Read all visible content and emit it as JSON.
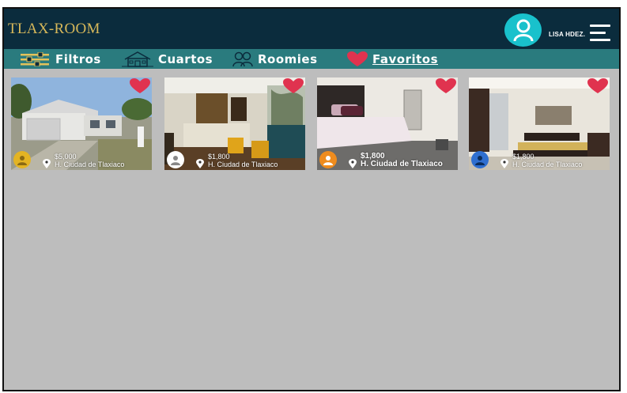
{
  "app": {
    "logo": "TLAX-ROOM"
  },
  "header": {
    "username": "LISA HDEZ."
  },
  "nav": {
    "filtros": "Filtros",
    "cuartos": "Cuartos",
    "roomies": "Roomies",
    "favoritos": "Favoritos"
  },
  "colors": {
    "topbar": "#0b2c3d",
    "navbar": "#2a7b7e",
    "logo": "#d7b85a",
    "heart": "#e0334f",
    "avatar": "#19c1cc",
    "content_bg": "#bdbdbd"
  },
  "listings": [
    {
      "price": "$5,000",
      "location": "H. Ciudad de Tlaxiaco",
      "owner_color": "#e3b423",
      "favorite": true
    },
    {
      "price": "$1,800",
      "location": "H. Ciudad de Tlaxiaco",
      "owner_color": "#ffffff",
      "favorite": true
    },
    {
      "price": "$1,800",
      "location": "H. Ciudad de Tlaxiaco",
      "owner_color": "#ef8c1e",
      "favorite": true
    },
    {
      "price": "$1,800",
      "location": "H. Ciudad de Tlaxiaco",
      "owner_color": "#2f6fd0",
      "favorite": true
    }
  ]
}
